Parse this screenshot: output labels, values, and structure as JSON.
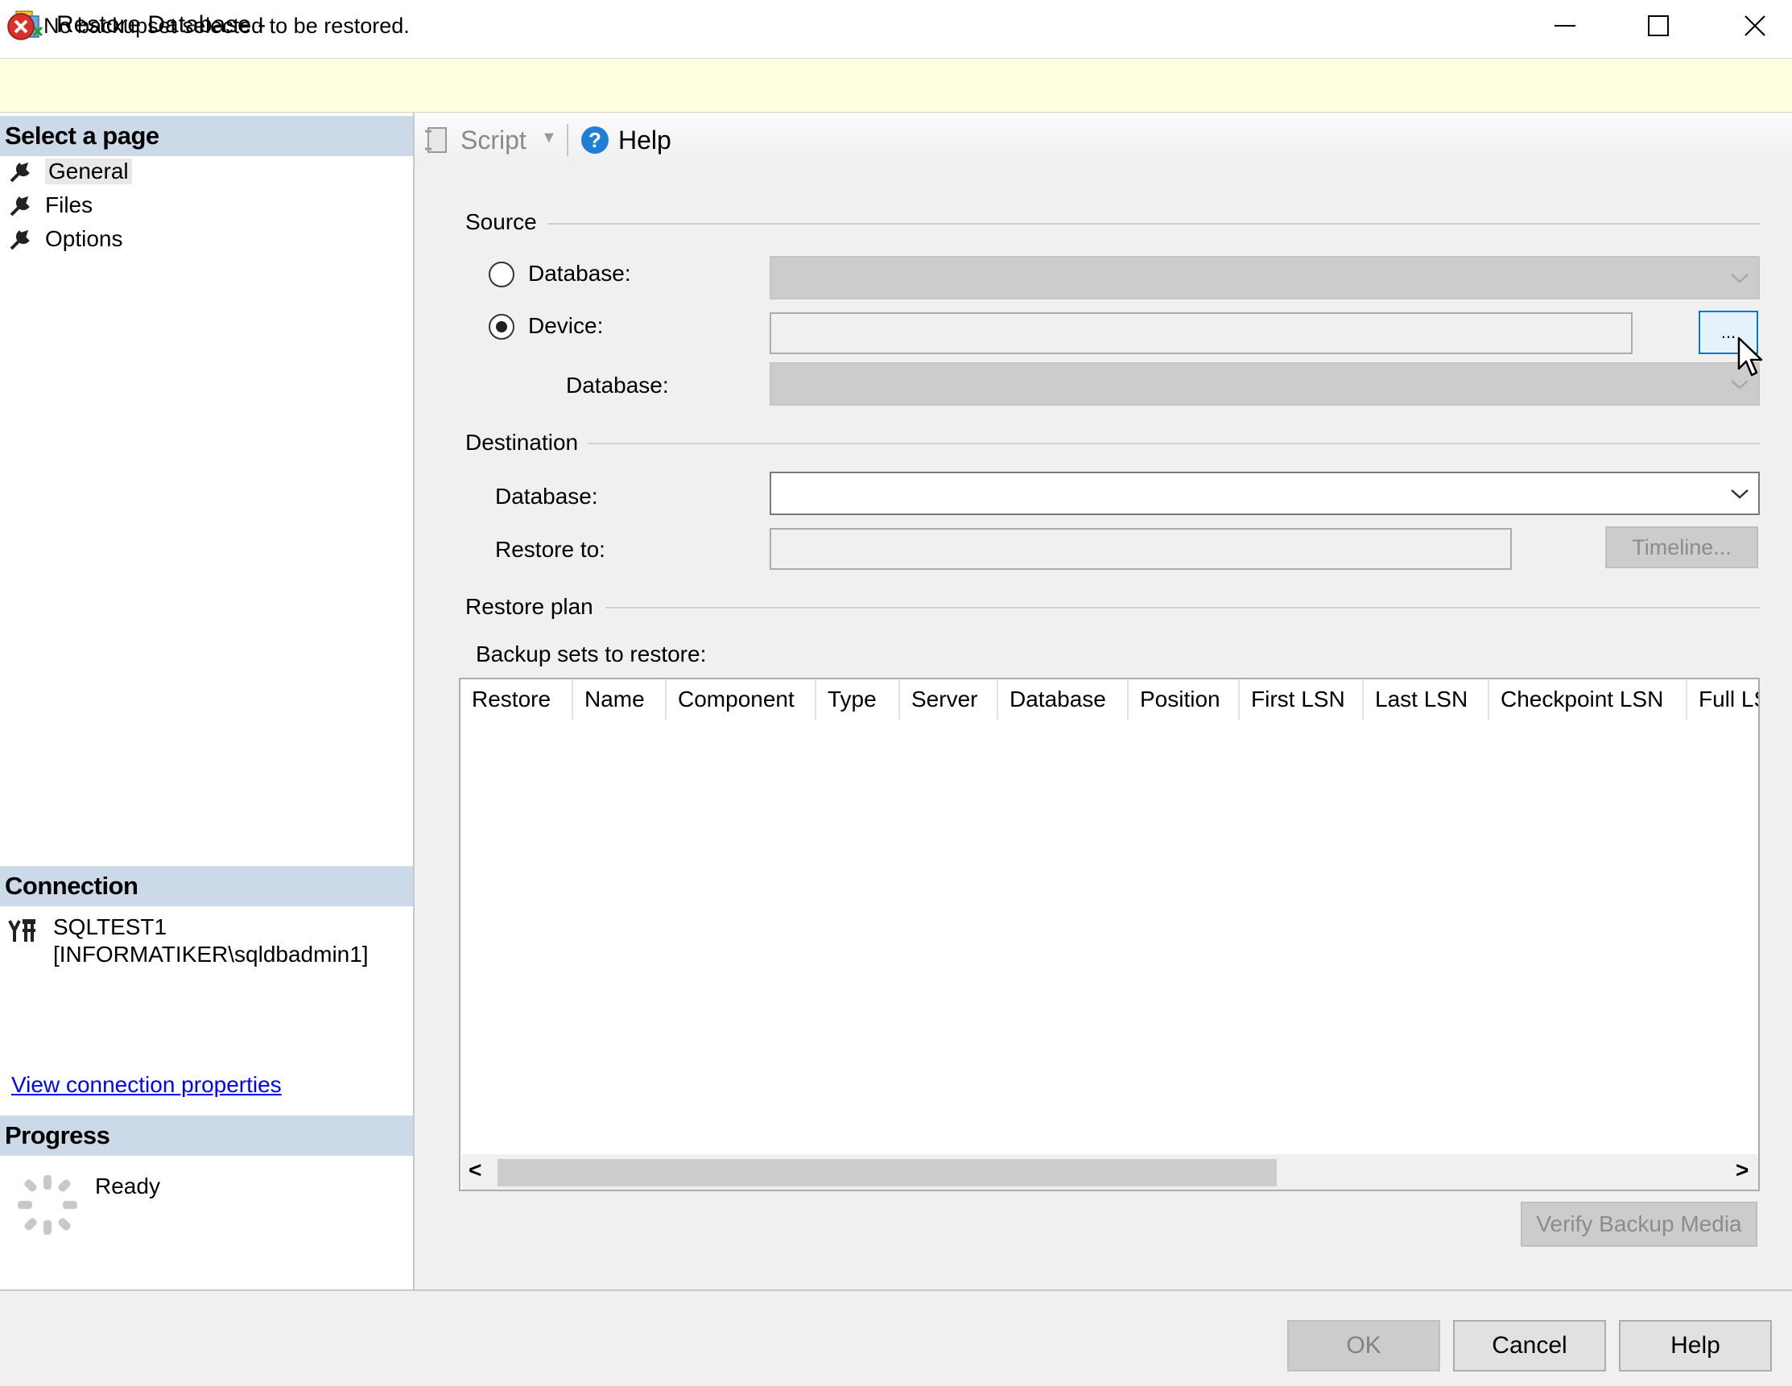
{
  "window": {
    "title": "Restore Database -",
    "minimize_glyph": "—",
    "maximize_glyph": "☐",
    "close_glyph": "✕"
  },
  "info_bar": {
    "icon": "error-icon",
    "message": "No backupset selected to be restored."
  },
  "left_panel": {
    "select_page_header": "Select a page",
    "pages": [
      {
        "label": "General",
        "icon": "wrench-icon",
        "selected": true
      },
      {
        "label": "Files",
        "icon": "wrench-icon"
      },
      {
        "label": "Options",
        "icon": "wrench-icon"
      }
    ],
    "connection_header": "Connection",
    "connection_server": "SQLTEST1",
    "connection_user": "[INFORMATIKER\\sqldbadmin1]",
    "view_connection_link": "View connection properties",
    "progress_header": "Progress",
    "progress_status": "Ready"
  },
  "toolbar": {
    "script_label": "Script",
    "script_dropdown_glyph": "▼",
    "help_label": "Help"
  },
  "source": {
    "group_label": "Source",
    "database_radio_label": "Database:",
    "device_radio_label": "Device:",
    "device_database_label": "Database:",
    "browse_button_label": "...",
    "selected_option": "Device"
  },
  "destination": {
    "group_label": "Destination",
    "database_label": "Database:",
    "database_value": "",
    "restore_to_label": "Restore to:",
    "restore_to_value": "",
    "timeline_button": "Timeline..."
  },
  "restore_plan": {
    "group_label": "Restore plan",
    "backup_sets_label": "Backup sets to restore:",
    "columns": [
      "Restore",
      "Name",
      "Component",
      "Type",
      "Server",
      "Database",
      "Position",
      "First LSN",
      "Last LSN",
      "Checkpoint LSN",
      "Full LSN"
    ],
    "rows": [],
    "scroll_left_glyph": "<",
    "scroll_right_glyph": ">",
    "verify_button": "Verify Backup Media"
  },
  "footer": {
    "ok_button": "OK",
    "cancel_button": "Cancel",
    "help_button": "Help"
  }
}
